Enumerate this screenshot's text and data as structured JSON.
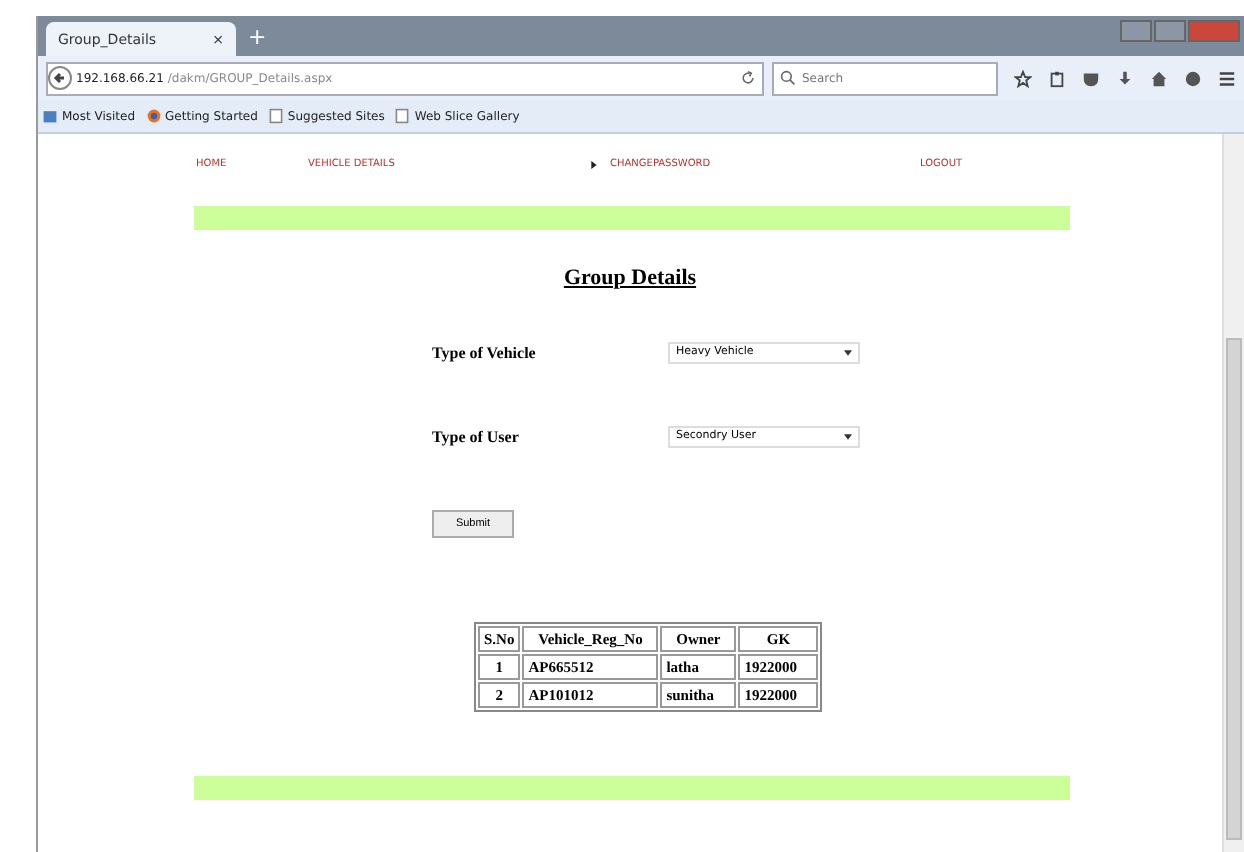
{
  "browser": {
    "tabs": [
      {
        "label": "Group_Details",
        "close": "×",
        "selected": true
      }
    ],
    "new_tab": "+",
    "url_host": "192.168.66.21",
    "url_path": "/dakm/GROUP_Details.aspx",
    "search": {
      "placeholder": "Search"
    },
    "bookmarks": [
      {
        "label": "Most Visited",
        "kind": "folder"
      },
      {
        "label": "Getting Started",
        "kind": "globe"
      },
      {
        "label": "Suggested Sites",
        "kind": "page"
      },
      {
        "label": "Web Slice Gallery",
        "kind": "page"
      }
    ]
  },
  "nav": [
    {
      "label": "HOME",
      "arrow": false
    },
    {
      "label": "VEHICLE DETAILS",
      "arrow": false
    },
    {
      "label": "CHANGEPASSWORD",
      "arrow": true
    },
    {
      "label": "LOGOUT",
      "arrow": false
    }
  ],
  "page_title": "Group Details",
  "form": [
    {
      "label": "Type of Vehicle",
      "value": "Heavy Vehicle"
    },
    {
      "label": "Type of User",
      "value": "Secondry User"
    }
  ],
  "submit": "Submit",
  "table": {
    "columns": [
      "S.No",
      "Vehicle_Reg_No",
      "Owner",
      "GK"
    ],
    "rows": [
      [
        "1",
        "AP665512",
        "latha",
        "1922000"
      ],
      [
        "2",
        "AP101012",
        "sunitha",
        "1922000"
      ]
    ]
  }
}
